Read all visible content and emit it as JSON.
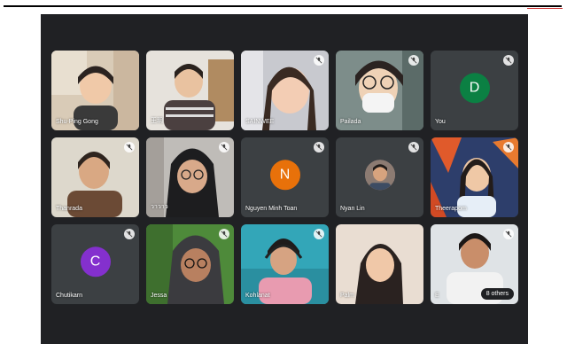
{
  "participants": [
    {
      "name": "Shu-Ping Gong",
      "type": "video"
    },
    {
      "name": "王玥",
      "type": "video"
    },
    {
      "name": "SAINWEE",
      "type": "video"
    },
    {
      "name": "Pailada",
      "type": "video"
    },
    {
      "name": "You",
      "type": "letter",
      "letter": "D",
      "color": "#0b8043"
    },
    {
      "name": "Thanrada",
      "type": "video"
    },
    {
      "name": "วาวาว",
      "type": "video"
    },
    {
      "name": "Nguyen Minh Toan",
      "type": "letter",
      "letter": "N",
      "color": "#e8710a"
    },
    {
      "name": "Nyan Lin",
      "type": "photo"
    },
    {
      "name": "Theerapom",
      "type": "video"
    },
    {
      "name": "Chutikarn",
      "type": "letter",
      "letter": "C",
      "color": "#8430ce"
    },
    {
      "name": "Jessa",
      "type": "video"
    },
    {
      "name": "Kohlanat",
      "type": "video"
    },
    {
      "name": "Palm",
      "type": "video"
    },
    {
      "name": "E",
      "type": "video"
    }
  ],
  "others_label": "8 others",
  "icons": {
    "muted": "mic-off-icon"
  }
}
